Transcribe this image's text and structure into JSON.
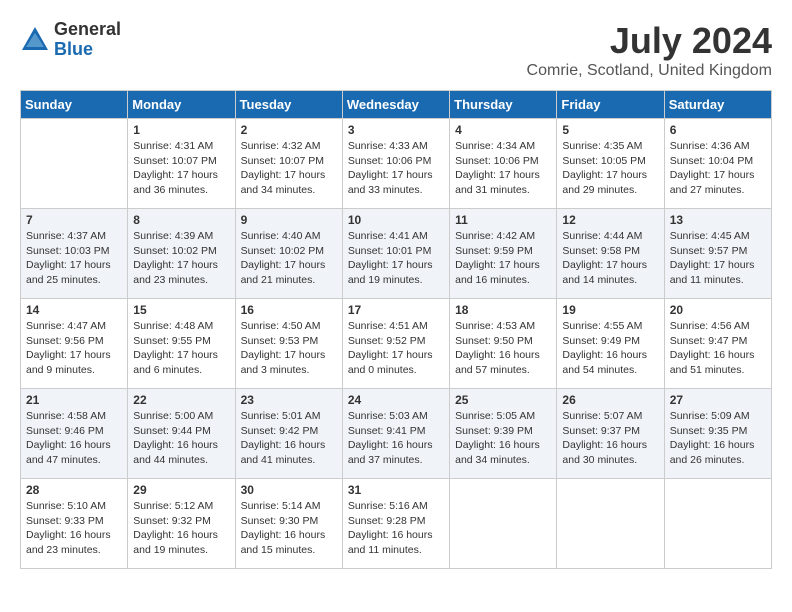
{
  "header": {
    "logo_general": "General",
    "logo_blue": "Blue",
    "month_title": "July 2024",
    "location": "Comrie, Scotland, United Kingdom"
  },
  "calendar": {
    "days": [
      "Sunday",
      "Monday",
      "Tuesday",
      "Wednesday",
      "Thursday",
      "Friday",
      "Saturday"
    ],
    "weeks": [
      [
        {
          "date": "",
          "content": ""
        },
        {
          "date": "1",
          "content": "Sunrise: 4:31 AM\nSunset: 10:07 PM\nDaylight: 17 hours\nand 36 minutes."
        },
        {
          "date": "2",
          "content": "Sunrise: 4:32 AM\nSunset: 10:07 PM\nDaylight: 17 hours\nand 34 minutes."
        },
        {
          "date": "3",
          "content": "Sunrise: 4:33 AM\nSunset: 10:06 PM\nDaylight: 17 hours\nand 33 minutes."
        },
        {
          "date": "4",
          "content": "Sunrise: 4:34 AM\nSunset: 10:06 PM\nDaylight: 17 hours\nand 31 minutes."
        },
        {
          "date": "5",
          "content": "Sunrise: 4:35 AM\nSunset: 10:05 PM\nDaylight: 17 hours\nand 29 minutes."
        },
        {
          "date": "6",
          "content": "Sunrise: 4:36 AM\nSunset: 10:04 PM\nDaylight: 17 hours\nand 27 minutes."
        }
      ],
      [
        {
          "date": "7",
          "content": "Sunrise: 4:37 AM\nSunset: 10:03 PM\nDaylight: 17 hours\nand 25 minutes."
        },
        {
          "date": "8",
          "content": "Sunrise: 4:39 AM\nSunset: 10:02 PM\nDaylight: 17 hours\nand 23 minutes."
        },
        {
          "date": "9",
          "content": "Sunrise: 4:40 AM\nSunset: 10:02 PM\nDaylight: 17 hours\nand 21 minutes."
        },
        {
          "date": "10",
          "content": "Sunrise: 4:41 AM\nSunset: 10:01 PM\nDaylight: 17 hours\nand 19 minutes."
        },
        {
          "date": "11",
          "content": "Sunrise: 4:42 AM\nSunset: 9:59 PM\nDaylight: 17 hours\nand 16 minutes."
        },
        {
          "date": "12",
          "content": "Sunrise: 4:44 AM\nSunset: 9:58 PM\nDaylight: 17 hours\nand 14 minutes."
        },
        {
          "date": "13",
          "content": "Sunrise: 4:45 AM\nSunset: 9:57 PM\nDaylight: 17 hours\nand 11 minutes."
        }
      ],
      [
        {
          "date": "14",
          "content": "Sunrise: 4:47 AM\nSunset: 9:56 PM\nDaylight: 17 hours\nand 9 minutes."
        },
        {
          "date": "15",
          "content": "Sunrise: 4:48 AM\nSunset: 9:55 PM\nDaylight: 17 hours\nand 6 minutes."
        },
        {
          "date": "16",
          "content": "Sunrise: 4:50 AM\nSunset: 9:53 PM\nDaylight: 17 hours\nand 3 minutes."
        },
        {
          "date": "17",
          "content": "Sunrise: 4:51 AM\nSunset: 9:52 PM\nDaylight: 17 hours\nand 0 minutes."
        },
        {
          "date": "18",
          "content": "Sunrise: 4:53 AM\nSunset: 9:50 PM\nDaylight: 16 hours\nand 57 minutes."
        },
        {
          "date": "19",
          "content": "Sunrise: 4:55 AM\nSunset: 9:49 PM\nDaylight: 16 hours\nand 54 minutes."
        },
        {
          "date": "20",
          "content": "Sunrise: 4:56 AM\nSunset: 9:47 PM\nDaylight: 16 hours\nand 51 minutes."
        }
      ],
      [
        {
          "date": "21",
          "content": "Sunrise: 4:58 AM\nSunset: 9:46 PM\nDaylight: 16 hours\nand 47 minutes."
        },
        {
          "date": "22",
          "content": "Sunrise: 5:00 AM\nSunset: 9:44 PM\nDaylight: 16 hours\nand 44 minutes."
        },
        {
          "date": "23",
          "content": "Sunrise: 5:01 AM\nSunset: 9:42 PM\nDaylight: 16 hours\nand 41 minutes."
        },
        {
          "date": "24",
          "content": "Sunrise: 5:03 AM\nSunset: 9:41 PM\nDaylight: 16 hours\nand 37 minutes."
        },
        {
          "date": "25",
          "content": "Sunrise: 5:05 AM\nSunset: 9:39 PM\nDaylight: 16 hours\nand 34 minutes."
        },
        {
          "date": "26",
          "content": "Sunrise: 5:07 AM\nSunset: 9:37 PM\nDaylight: 16 hours\nand 30 minutes."
        },
        {
          "date": "27",
          "content": "Sunrise: 5:09 AM\nSunset: 9:35 PM\nDaylight: 16 hours\nand 26 minutes."
        }
      ],
      [
        {
          "date": "28",
          "content": "Sunrise: 5:10 AM\nSunset: 9:33 PM\nDaylight: 16 hours\nand 23 minutes."
        },
        {
          "date": "29",
          "content": "Sunrise: 5:12 AM\nSunset: 9:32 PM\nDaylight: 16 hours\nand 19 minutes."
        },
        {
          "date": "30",
          "content": "Sunrise: 5:14 AM\nSunset: 9:30 PM\nDaylight: 16 hours\nand 15 minutes."
        },
        {
          "date": "31",
          "content": "Sunrise: 5:16 AM\nSunset: 9:28 PM\nDaylight: 16 hours\nand 11 minutes."
        },
        {
          "date": "",
          "content": ""
        },
        {
          "date": "",
          "content": ""
        },
        {
          "date": "",
          "content": ""
        }
      ]
    ]
  }
}
